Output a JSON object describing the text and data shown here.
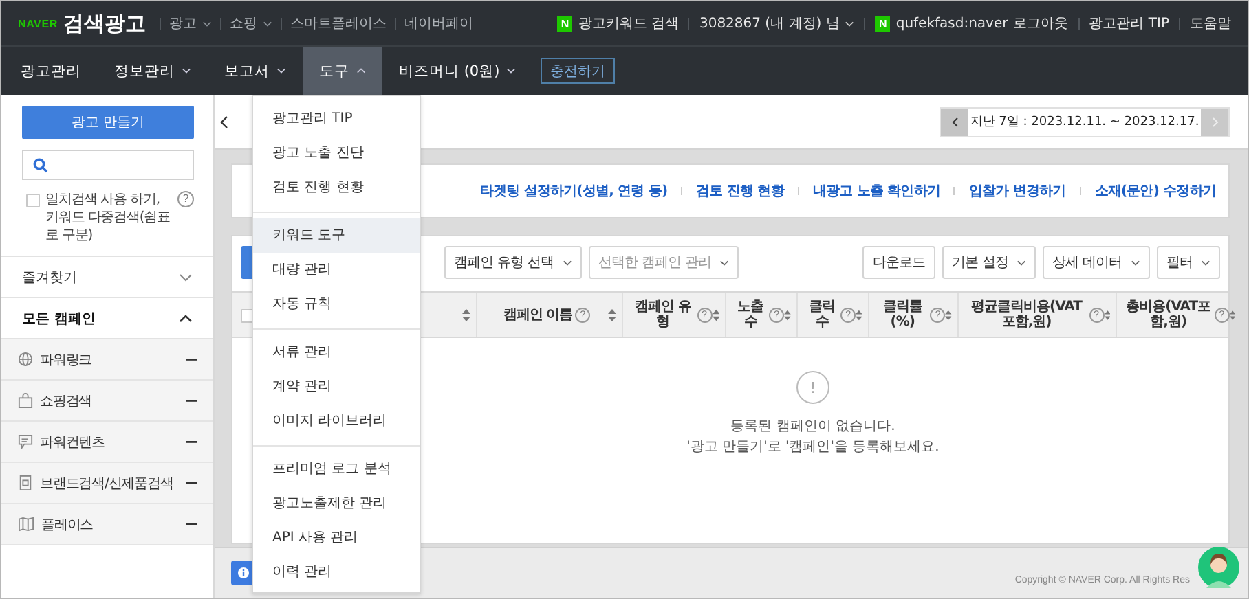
{
  "brand": {
    "logo": "NAVER",
    "title": "검색광고"
  },
  "top_links": [
    {
      "label": "광고",
      "has_menu": true
    },
    {
      "label": "쇼핑",
      "has_menu": true
    },
    {
      "label": "스마트플레이스",
      "has_menu": false
    },
    {
      "label": "네이버페이",
      "has_menu": false
    }
  ],
  "account": {
    "keyword_badge": "N",
    "keyword_search": "광고키워드 검색",
    "account_name": "3082867 (내 계정) 님",
    "user_badge": "N",
    "user": "qufekfasd:naver",
    "logout": "로그아웃",
    "tip": "광고관리 TIP",
    "help": "도움말"
  },
  "nav_tabs": [
    {
      "label": "광고관리",
      "kind": "plain",
      "selected": false
    },
    {
      "label": "정보관리",
      "kind": "dropdown",
      "selected": false,
      "expanded": false
    },
    {
      "label": "보고서",
      "kind": "dropdown",
      "selected": false,
      "expanded": false
    },
    {
      "label": "도구",
      "kind": "dropdown",
      "selected": true,
      "expanded": true
    },
    {
      "label": "비즈머니 (0원)",
      "kind": "dropdown",
      "selected": false,
      "expanded": false
    }
  ],
  "charge_button": "충전하기",
  "sidebar": {
    "create_button": "광고 만들기",
    "exact_match": {
      "line1": "일치검색 사용 하기,",
      "line2": "키워드 다중검색(쉼표로 구분)",
      "checked": false,
      "help": "?"
    },
    "favorites": {
      "label": "즐겨찾기",
      "expanded": false
    },
    "campaigns": {
      "label": "모든 캠페인",
      "expanded": true,
      "items": [
        {
          "label": "파워링크",
          "kind": "globe"
        },
        {
          "label": "쇼핑검색",
          "kind": "bag"
        },
        {
          "label": "파워컨텐츠",
          "kind": "chat"
        },
        {
          "label": "브랜드검색/신제품검색",
          "kind": "document"
        },
        {
          "label": "플레이스",
          "kind": "map"
        }
      ]
    }
  },
  "page": {
    "date_range": "지난 7일 : 2023.12.11. ~ 2023.12.17."
  },
  "quick_links": [
    "타겟팅 설정하기(성별, 연령 등)",
    "검토 진행 현황",
    "내광고 노출 확인하기",
    "입찰가 변경하기",
    "소재(문안) 수정하기"
  ],
  "toolbar": {
    "left": [
      {
        "label": "캠페인 유형 선택",
        "disabled": false
      },
      {
        "label": "선택한 캠페인 관리",
        "disabled": true
      }
    ],
    "right": [
      {
        "label": "다운로드",
        "dropdown": false
      },
      {
        "label": "기본 설정",
        "dropdown": true
      },
      {
        "label": "상세 데이터",
        "dropdown": true
      },
      {
        "label": "필터",
        "dropdown": true
      }
    ]
  },
  "table": {
    "select_all": false,
    "columns": [
      {
        "kind": "select"
      },
      {
        "label": "캠페인 이름",
        "help": "?"
      },
      {
        "label": "캠페인 유형",
        "help": "?"
      },
      {
        "label": "노출수",
        "help": "?"
      },
      {
        "label": "클릭수",
        "help": "?"
      },
      {
        "label": "클릭률(%)",
        "help": "?"
      },
      {
        "label": "평균클릭비용(VAT포함,원)",
        "help": "?"
      },
      {
        "label": "총비용(VAT포함,원)",
        "help": "?"
      }
    ],
    "empty": {
      "mark": "!",
      "lines": [
        "등록된 캠페인이 없습니다.",
        "'광고 만들기'로 '캠페인'을 등록해보세요."
      ]
    }
  },
  "footer": {
    "copyright": "Copyright © NAVER Corp. All Rights Res"
  },
  "tools_menu": {
    "groups": [
      {
        "items": [
          {
            "label": "광고관리 TIP",
            "selected": false
          },
          {
            "label": "광고 노출 진단",
            "selected": false
          },
          {
            "label": "검토 진행 현황",
            "selected": false
          }
        ]
      },
      {
        "items": [
          {
            "label": "키워드 도구",
            "selected": true
          },
          {
            "label": "대량 관리",
            "selected": false
          },
          {
            "label": "자동 규칙",
            "selected": false
          }
        ]
      },
      {
        "items": [
          {
            "label": "서류 관리",
            "selected": false
          },
          {
            "label": "계약 관리",
            "selected": false
          },
          {
            "label": "이미지 라이브러리",
            "selected": false
          }
        ]
      },
      {
        "items": [
          {
            "label": "프리미엄 로그 분석",
            "selected": false
          },
          {
            "label": "광고노출제한 관리",
            "selected": false
          },
          {
            "label": "API 사용 관리",
            "selected": false
          },
          {
            "label": "이력 관리",
            "selected": false
          }
        ]
      }
    ]
  }
}
